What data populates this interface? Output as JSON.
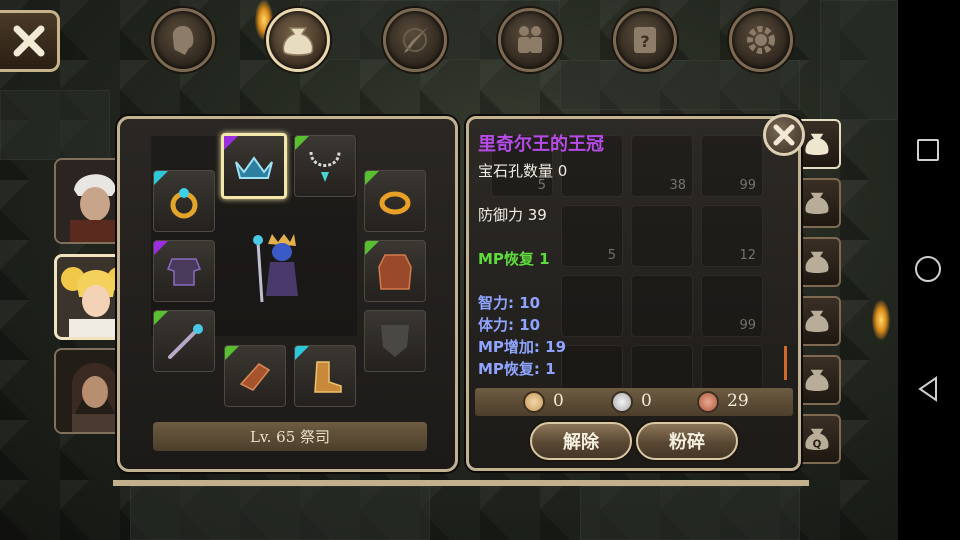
{
  "item": {
    "name": "里奇尔王的王冠",
    "gem_slots": "宝石孔数量 0",
    "defense": "防御力 39",
    "mp_regen_main": "MP恢复 1",
    "bonus_stats": [
      "智力: 10",
      "体力: 10",
      "MP增加: 19",
      "MP恢复: 1"
    ]
  },
  "character": {
    "level_class": "Lv. 65 祭司"
  },
  "currency": {
    "gold": "0",
    "silver": "0",
    "copper": "29"
  },
  "actions": {
    "unequip_label": "解除",
    "smash_label": "粉碎"
  },
  "inventory_counts": [
    "5",
    "38",
    "99",
    "5",
    "12",
    "99"
  ],
  "tabs": [
    "character-tab",
    "bag-tab",
    "skills-tab",
    "party-tab",
    "quest-scroll-tab",
    "settings-tab"
  ],
  "colors": {
    "item_name": "#b64bea",
    "mp_regen": "#5fdc3c",
    "bonus_stat": "#8fa4ff",
    "frame": "#c3b291",
    "rarity_purple": "#9b2ee0",
    "rarity_green": "#58c030",
    "rarity_teal": "#2ec6d9"
  }
}
